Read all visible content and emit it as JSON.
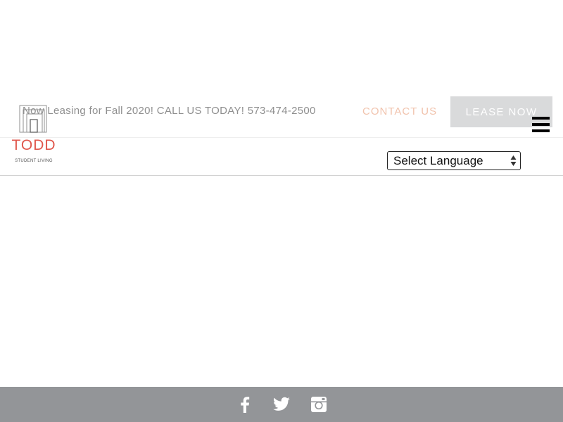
{
  "header": {
    "announcement": "Now Leasing for Fall 2020! CALL US TODAY! 573-474-2500",
    "contact_label": "CONTACT US",
    "lease_label": "LEASE NOW"
  },
  "logo": {
    "name": "TODD",
    "tagline": "STUDENT LIVING"
  },
  "language": {
    "selected": "Select Language"
  },
  "colors": {
    "brand_red": "#e0574c",
    "contact_peach": "#f1c3ad",
    "lease_button_bg": "#d9dadb",
    "footer_bg": "#939598"
  },
  "footer": {
    "social": [
      {
        "icon": "facebook-icon"
      },
      {
        "icon": "twitter-icon"
      },
      {
        "icon": "instagram-icon"
      }
    ]
  }
}
